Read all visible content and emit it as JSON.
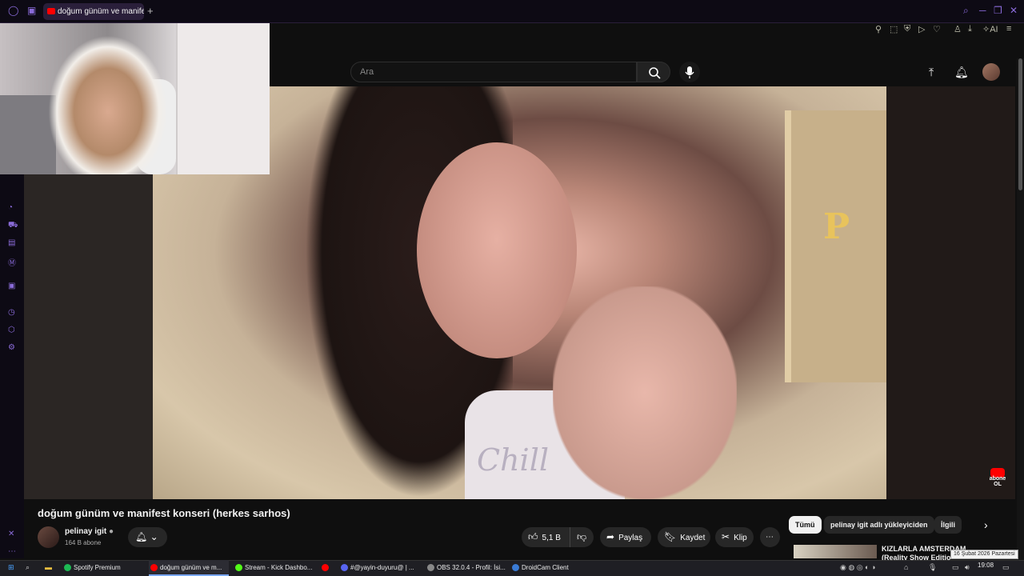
{
  "browser": {
    "tab_title": "doğum günüm ve manifest",
    "new_tab": "+"
  },
  "youtube": {
    "search_placeholder": "Ara"
  },
  "video": {
    "title": "doğum günüm ve manifest konseri (herkes sarhos)",
    "shirt_text": "Chill",
    "abone_label": "abone OL"
  },
  "channel": {
    "name": "pelinay igit",
    "subscribers": "164 B abone"
  },
  "actions": {
    "likes": "5,1 B",
    "share": "Paylaş",
    "save": "Kaydet",
    "clip": "Klip",
    "more": "⋯"
  },
  "chips": [
    "Tümü",
    "pelinay igit adlı yükleyiciden",
    "İlgili"
  ],
  "recommended": {
    "title_line1": "KIZLARLA AMSTERDAM",
    "title_line2": "(Reality Show Editio"
  },
  "tooltip": "16 Şubat 2026 Pazartesi",
  "taskbar": {
    "items": [
      {
        "label": "Spotify Premium",
        "color": "#1db954"
      },
      {
        "label": "doğum günüm ve m...",
        "color": "#ff0000"
      },
      {
        "label": "Stream - Kick Dashbo...",
        "color": "#53fc18"
      },
      {
        "label": "",
        "color": "#ff0000"
      },
      {
        "label": "#@yayin-duyuru@ | ...",
        "color": "#5865f2"
      },
      {
        "label": "OBS 32.0.4 - Profil: İsi...",
        "color": "#302e31"
      },
      {
        "label": "DroidCam Client",
        "color": "#3a7bd5"
      }
    ],
    "clock": "19:08"
  },
  "toolbar": {
    "ai_label": "AI"
  }
}
